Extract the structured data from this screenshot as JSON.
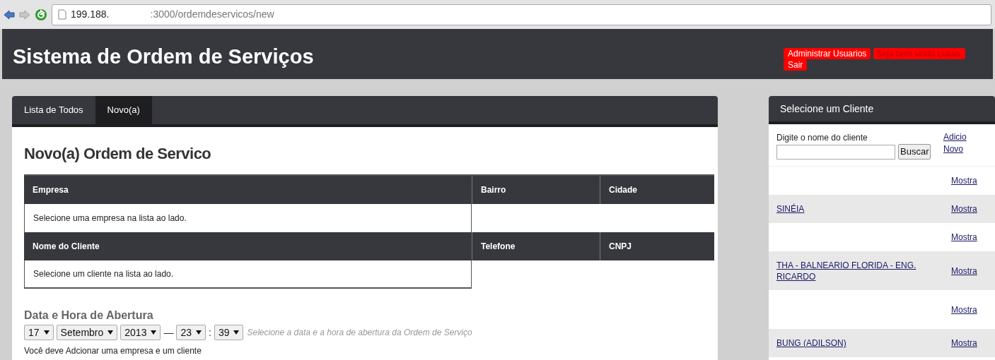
{
  "browser": {
    "url_host": "199.188.",
    "url_path": ":3000/ordemdeservicos/new"
  },
  "header": {
    "title": "Sistema de Ordem de Serviços",
    "nav": [
      {
        "kind": "link",
        "label": "Administrar Usuarios"
      },
      {
        "kind": "greeting",
        "label": "Seja bem vindo Lukas."
      },
      {
        "kind": "link",
        "label": "Sair"
      }
    ]
  },
  "main": {
    "tabs": [
      {
        "label": "Lista de Todos",
        "selected": false
      },
      {
        "label": "Novo(a)",
        "selected": true
      }
    ],
    "heading": "Novo(a) Ordem de Servico",
    "table": {
      "sections": [
        {
          "columns": [
            "Empresa",
            "Bairro",
            "Cidade"
          ],
          "message": "Selecione uma empresa na lista ao lado."
        },
        {
          "columns": [
            "Nome do Cliente",
            "Telefone",
            "CNPJ"
          ],
          "message": "Selecione um cliente na lista ao lado."
        }
      ]
    },
    "date_label": "Data e Hora de Abertura",
    "date_selects": [
      {
        "kind": "select",
        "value": "17"
      },
      {
        "kind": "select",
        "value": "Setembro"
      },
      {
        "kind": "select",
        "value": "2013"
      },
      {
        "kind": "separator",
        "value": "—"
      },
      {
        "kind": "select",
        "value": "23"
      },
      {
        "kind": "separator",
        "value": ":"
      },
      {
        "kind": "select",
        "value": "39"
      }
    ],
    "date_hint": "Selecione a data e a hora de abertura da Ordem de Serviço",
    "warning": "Você deve Adcionar uma empresa e um cliente"
  },
  "sidebar": {
    "title": "Selecione um Cliente",
    "search_label": "Digite o nome do cliente",
    "search_button": "Buscar",
    "add_link": [
      "Adicio",
      "Novo"
    ],
    "clients": [
      {
        "action": "Mostra"
      },
      {
        "name": "SINÉIA",
        "action": "Mostra"
      },
      {
        "action": "Mostra"
      },
      {
        "name": "THA - BALNEARIO FLORIDA - ENG. RICARDO",
        "action": "Mostra"
      },
      {
        "action": "Mostra"
      },
      {
        "name": "BUNG (ADILSON)",
        "action": "Mostra"
      }
    ]
  }
}
